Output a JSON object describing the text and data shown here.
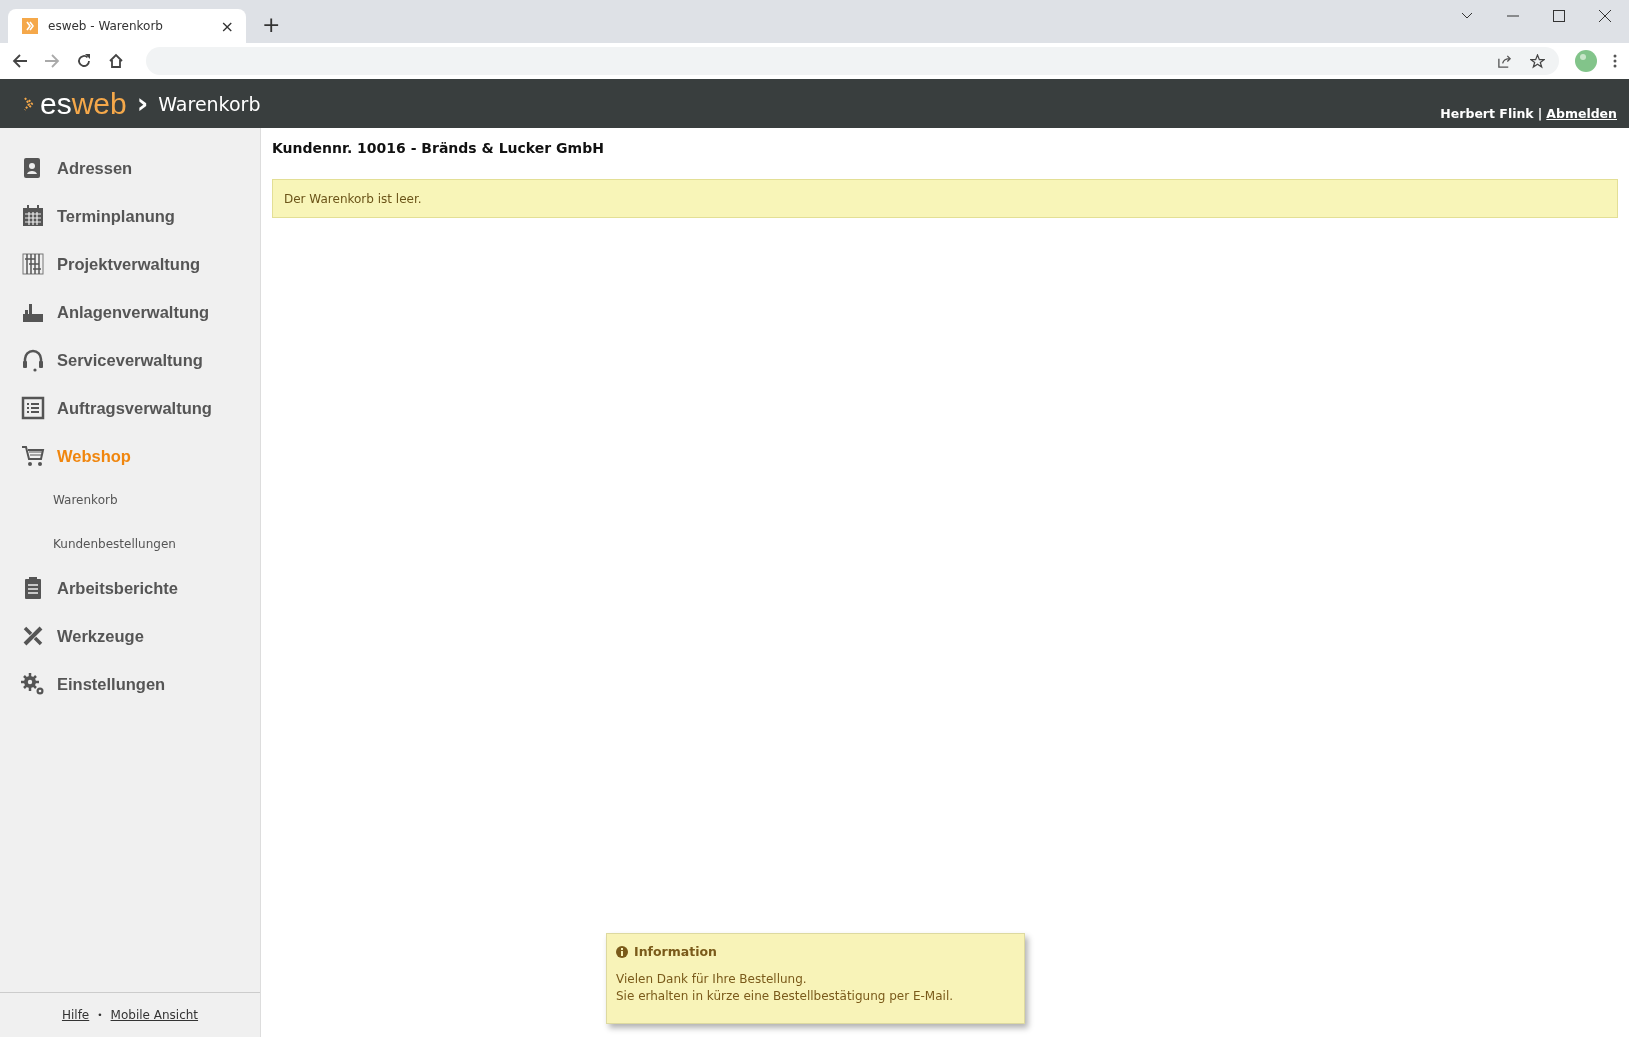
{
  "browser": {
    "tab_title": "esweb - Warenkorb",
    "close_tab": "×",
    "new_tab": "+"
  },
  "header": {
    "logo_es": "es",
    "logo_web": "web",
    "breadcrumb_sep": "›",
    "page_title": "Warenkorb",
    "user": "Herbert Flink",
    "separator": "|",
    "logout": "Abmelden"
  },
  "sidebar": {
    "items": [
      {
        "label": "Adressen",
        "selected": false
      },
      {
        "label": "Terminplanung",
        "selected": false
      },
      {
        "label": "Projektverwaltung",
        "selected": false
      },
      {
        "label": "Anlagenverwaltung",
        "selected": false
      },
      {
        "label": "Serviceverwaltung",
        "selected": false
      },
      {
        "label": "Auftragsverwaltung",
        "selected": false
      },
      {
        "label": "Webshop",
        "selected": true,
        "children": [
          {
            "label": "Warenkorb"
          },
          {
            "label": "Kundenbestellungen"
          }
        ]
      },
      {
        "label": "Arbeitsberichte",
        "selected": false
      },
      {
        "label": "Werkzeuge",
        "selected": false
      },
      {
        "label": "Einstellungen",
        "selected": false
      }
    ],
    "footer": {
      "help": "Hilfe",
      "dot": "•",
      "mobile": "Mobile Ansicht"
    }
  },
  "content": {
    "title": "Kundennr. 10016 - Bränds & Lucker GmbH",
    "notice": "Der Warenkorb ist leer."
  },
  "popup": {
    "title": "Information",
    "lines": [
      "Vielen Dank für Ihre Bestellung.",
      "Sie erhalten in kürze eine Bestellbestätigung per E-Mail."
    ]
  }
}
